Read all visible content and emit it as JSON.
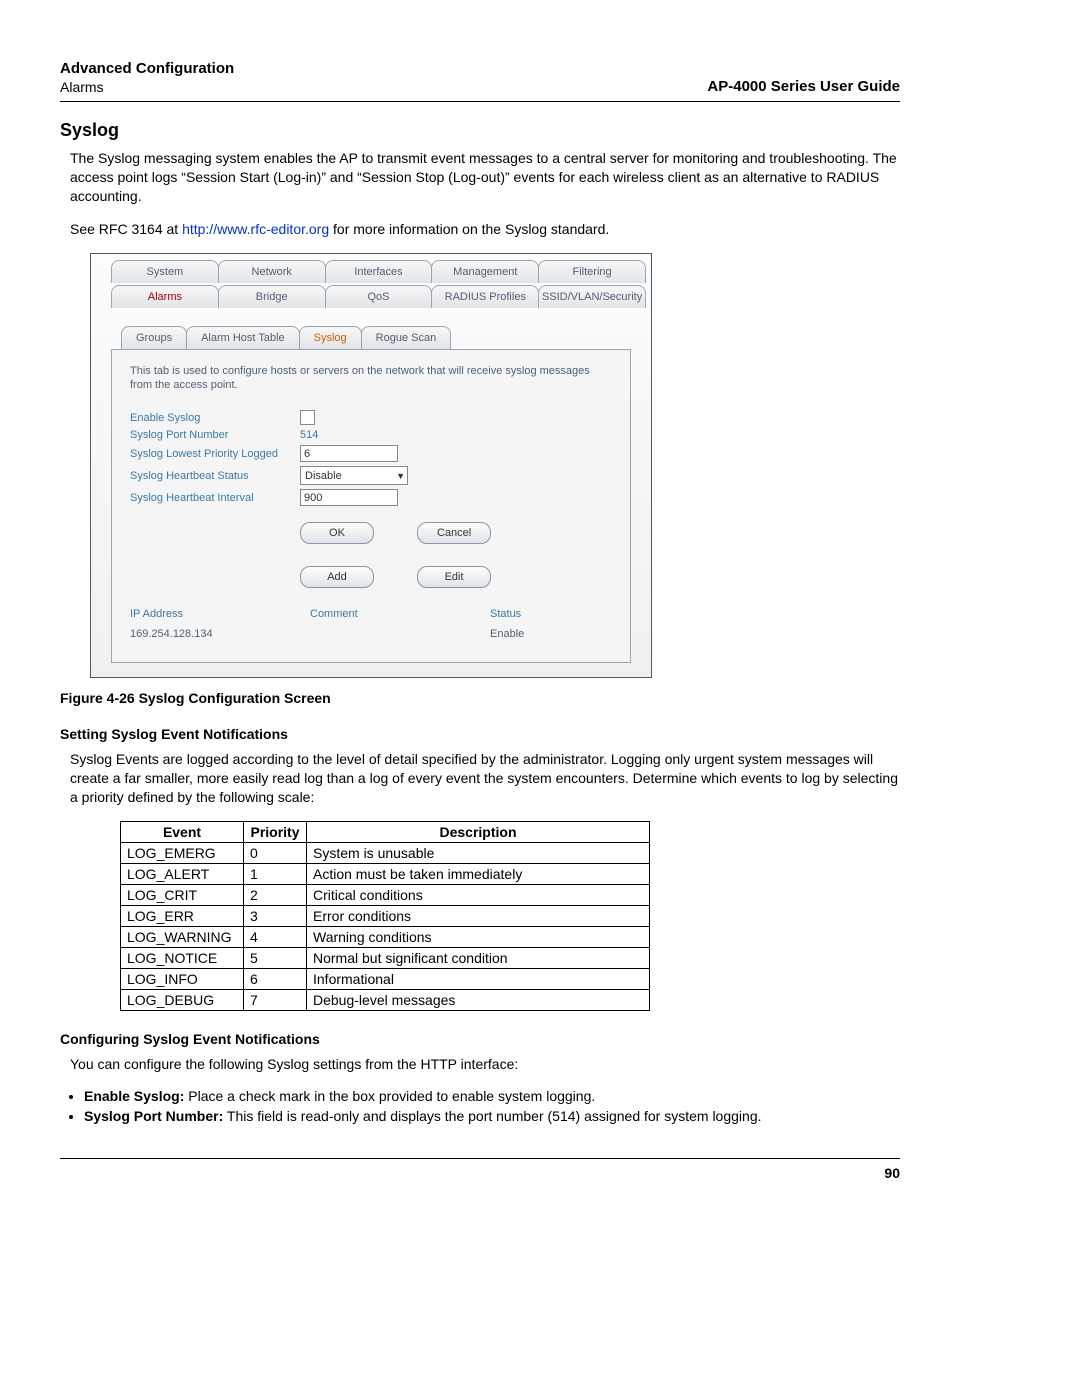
{
  "header": {
    "title": "Advanced Configuration",
    "subtitle": "Alarms",
    "guide": "AP-4000 Series User Guide"
  },
  "section": {
    "heading": "Syslog",
    "intro": "The Syslog messaging system enables the AP to transmit event messages to a central server for monitoring and troubleshooting. The access point logs “Session Start (Log-in)” and “Session Stop (Log-out)” events for each wireless client as an alternative to RADIUS accounting.",
    "see_pre": "See RFC 3164 at ",
    "see_link": "http://www.rfc-editor.org",
    "see_post": " for more information on the Syslog standard."
  },
  "shot": {
    "tabs1": [
      "System",
      "Network",
      "Interfaces",
      "Management",
      "Filtering"
    ],
    "tabs2": [
      "Alarms",
      "Bridge",
      "QoS",
      "RADIUS Profiles",
      "SSID/VLAN/Security"
    ],
    "subtabs": [
      "Groups",
      "Alarm Host Table",
      "Syslog",
      "Rogue Scan"
    ],
    "active_subtab": "Syslog",
    "desc": "This tab is used to configure hosts or servers on the network that will receive syslog messages from the access point.",
    "fields": {
      "enable_label": "Enable Syslog",
      "port_label": "Syslog Port Number",
      "port_value": "514",
      "priority_label": "Syslog Lowest Priority Logged",
      "priority_value": "6",
      "hb_status_label": "Syslog Heartbeat Status",
      "hb_status_value": "Disable",
      "hb_interval_label": "Syslog Heartbeat Interval",
      "hb_interval_value": "900"
    },
    "buttons": {
      "ok": "OK",
      "cancel": "Cancel",
      "add": "Add",
      "edit": "Edit"
    },
    "table": {
      "h1": "IP Address",
      "h2": "Comment",
      "h3": "Status",
      "r1c1": "169.254.128.134",
      "r1c2": "",
      "r1c3": "Enable"
    }
  },
  "figcap": "Figure 4-26 Syslog Configuration Screen",
  "sect2": {
    "heading": "Setting Syslog Event Notifications",
    "para": "Syslog Events are logged according to the level of detail specified by the administrator. Logging only urgent system messages will create a far smaller, more easily read log than a log of every event the system encounters. Determine which events to log by selecting a priority defined by the following scale:"
  },
  "prio": {
    "head": [
      "Event",
      "Priority",
      "Description"
    ],
    "rows": [
      [
        "LOG_EMERG",
        "0",
        "System is unusable"
      ],
      [
        "LOG_ALERT",
        "1",
        "Action must be taken immediately"
      ],
      [
        "LOG_CRIT",
        "2",
        "Critical conditions"
      ],
      [
        "LOG_ERR",
        "3",
        "Error conditions"
      ],
      [
        "LOG_WARNING",
        "4",
        "Warning conditions"
      ],
      [
        "LOG_NOTICE",
        "5",
        "Normal but significant condition"
      ],
      [
        "LOG_INFO",
        "6",
        "Informational"
      ],
      [
        "LOG_DEBUG",
        "7",
        "Debug-level messages"
      ]
    ]
  },
  "sect3": {
    "heading": "Configuring Syslog Event Notifications",
    "para": "You can configure the following Syslog settings from the HTTP interface:",
    "b1_label": "Enable Syslog:",
    "b1_text": " Place a check mark in the box provided to enable system logging.",
    "b2_label": "Syslog Port Number:",
    "b2_text": " This field is read-only and displays the port number (514) assigned for system logging."
  },
  "page_no": "90"
}
